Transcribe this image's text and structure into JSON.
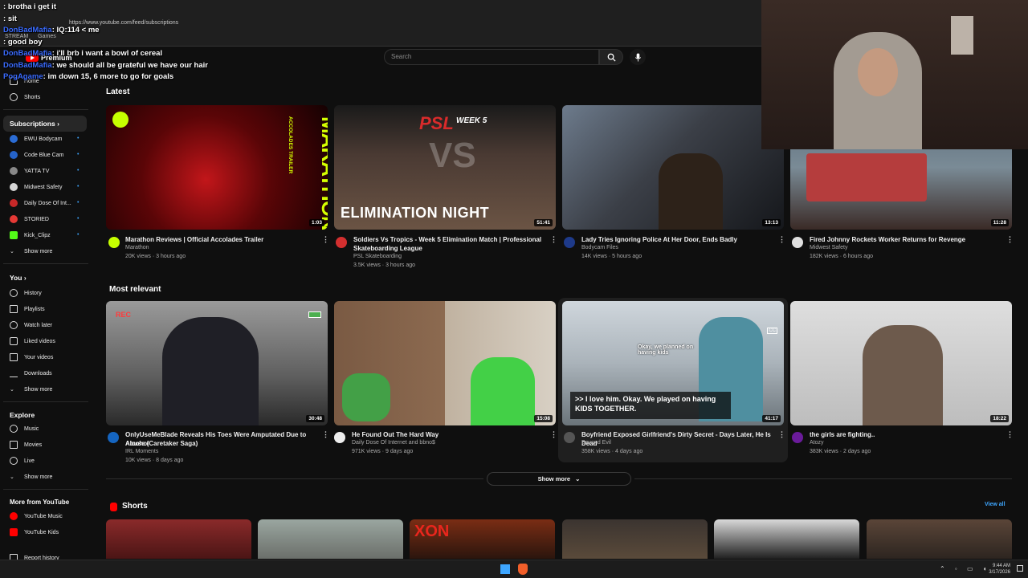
{
  "browser": {
    "url": "https://www.youtube.com/feed/subscriptions",
    "tabs": [
      "STREAM",
      "Games"
    ]
  },
  "chat": [
    {
      "user": "",
      "msg": "brotha i get it"
    },
    {
      "user": "",
      "msg": "sit"
    },
    {
      "user": "DonBadMafia",
      "msg": "IQ:114 < me"
    },
    {
      "user": "",
      "msg": "good boy"
    },
    {
      "user": "DonBadMafia",
      "msg": "i'll brb i want a bowl of cereal"
    },
    {
      "user": "DonBadMafia",
      "msg": "we should all be grateful we have our hair"
    },
    {
      "user": "PogAgame",
      "msg": "im down 15, 6 more to go for goals"
    }
  ],
  "header": {
    "premium_label": "Premium",
    "search_placeholder": "Search"
  },
  "sidebar": {
    "home": "Home",
    "shorts": "Shorts",
    "subscriptions_label": "Subscriptions",
    "subscriptions": [
      {
        "label": "EWU Bodycam",
        "color": "#2b6cd4"
      },
      {
        "label": "Code Blue Cam",
        "color": "#2563c9"
      },
      {
        "label": "YATTA TV",
        "color": "#888888"
      },
      {
        "label": "Midwest Safety",
        "color": "#d6d6d6"
      },
      {
        "label": "Daily Dose Of Int...",
        "color": "#c62828"
      },
      {
        "label": "STORIED",
        "color": "#e53935"
      },
      {
        "label": "Kick_Clipz",
        "color": "#53fc18"
      }
    ],
    "show_more": "Show more",
    "you_label": "You",
    "you_items": [
      "History",
      "Playlists",
      "Watch later",
      "Liked videos",
      "Your videos",
      "Downloads",
      "Show more"
    ],
    "explore_label": "Explore",
    "explore_items": [
      "Music",
      "Movies",
      "Live",
      "Show more"
    ],
    "more_label": "More from YouTube",
    "more_items": [
      "YouTube Music",
      "YouTube Kids"
    ],
    "report_history": "Report history"
  },
  "sections": {
    "latest": "Latest",
    "most_relevant": "Most relevant",
    "shorts": "Shorts",
    "show_more": "Show more",
    "view_all": "View all"
  },
  "latest_videos": [
    {
      "title": "Marathon Reviews | Official Accolades Trailer",
      "title2": "",
      "channel": "Marathon",
      "meta": "20K views · 3 hours ago",
      "duration": "1:03",
      "avatar": "#c6ff00"
    },
    {
      "title": "Soldiers Vs Tropics - Week 5 Elimination Match | Professional",
      "title2": "Skateboarding League",
      "channel": "PSL Skateboarding",
      "meta": "3.5K views · 3 hours ago",
      "duration": "51:41",
      "avatar": "#d32f2f"
    },
    {
      "title": "Lady Tries Ignoring Police At Her Door, Ends Badly",
      "title2": "",
      "channel": "Bodycam Files",
      "meta": "14K views · 5 hours ago",
      "duration": "13:13",
      "avatar": "#1e3a8a"
    },
    {
      "title": "Fired Johnny Rockets Worker Returns for Revenge",
      "title2": "",
      "channel": "Midwest Safety",
      "meta": "182K views · 6 hours ago",
      "duration": "11:28",
      "avatar": "#e0e0e0"
    }
  ],
  "relevant_videos": [
    {
      "title": "OnlyUseMeBlade Reveals His Toes Were Amputated Due to Alcohol",
      "title2": "Abuse (Caretaker Saga)",
      "channel": "IRL Moments",
      "meta": "10K views · 8 days ago",
      "duration": "30:48",
      "avatar": "#1565c0"
    },
    {
      "title": "He Found Out The Hard Way",
      "title2": "",
      "channel": "Daily Dose Of Internet  and bbno$",
      "meta": "971K views · 9 days ago",
      "duration": "15:08",
      "avatar": "#eeeeee"
    },
    {
      "title": "Boyfriend Exposed Girlfriend's Dirty Secret - Days Later, He Is Dead",
      "title2": "",
      "channel": "Beyond Evil",
      "meta": "358K views · 4 days ago",
      "duration": "41:17",
      "avatar": "#555555"
    },
    {
      "title": "the girls are fighting..",
      "title2": "",
      "channel": "Atozy",
      "meta": "383K views · 2 days ago",
      "duration": "18:22",
      "avatar": "#6a1b9a"
    }
  ],
  "thumb_text": {
    "marathon_vertical": "MARATHON",
    "marathon_sub": "ACCOLADES TRAILER",
    "psl_logo": "PSL",
    "psl_week": "WEEK 5",
    "psl_vs": "VS",
    "psl_banner": "ELIMINATION NIGHT",
    "rec": "REC",
    "caption_small": "Okay, we planned on having kids",
    "caption_big": ">> I love him. Okay. We played on having KIDS TOGETHER.",
    "cc": "CC",
    "shorts_text": "XON"
  },
  "tray": {
    "time": "9:44 AM",
    "date": "3/17/2026"
  },
  "colors": {
    "background": "#0f0f0f",
    "accent": "#3ea6ff",
    "chat_user": "#3b6cff"
  }
}
